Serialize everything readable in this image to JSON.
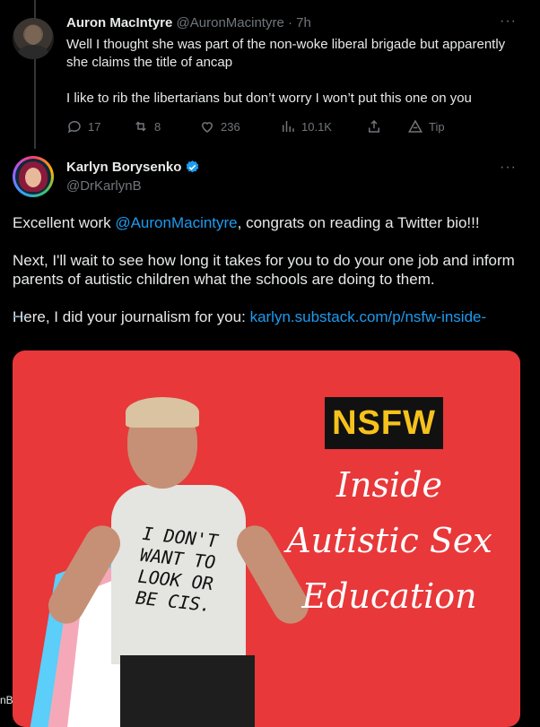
{
  "tweet1": {
    "name": "Auron MacIntyre",
    "handle": "@AuronMacintyre",
    "time": "7h",
    "more": "···",
    "line1": "Well I thought she was part of the non-woke liberal brigade but apparently she claims the title of ancap",
    "line2": "I like to rib the libertarians but don’t worry I won’t put this one on you",
    "actions": {
      "replies": "17",
      "retweets": "8",
      "likes": "236",
      "views": "10.1K",
      "tip": "Tip"
    }
  },
  "tweet2": {
    "name": "Karlyn Borysenko",
    "handle": "@DrKarlynB",
    "more": "···",
    "p1_pre": "Excellent work ",
    "p1_mention": "@AuronMacintyre",
    "p1_post": ", congrats on reading a Twitter bio!!!",
    "p2": "Next, I'll wait to see how long it takes for you to do your one job and inform parents of autistic children what the schools are doing to them.",
    "p3_pre": "Here, I did your journalism for you: ",
    "p3_link": "karlyn.substack.com/p/nsfw-inside-",
    "ellipsis": "…"
  },
  "media": {
    "badge": "NSFW",
    "line1": "Inside",
    "line2": "Autistic Sex",
    "line3": "Education",
    "shirt_l1": "I DON'T",
    "shirt_l2": "WANT TO",
    "shirt_l3": "LOOK OR",
    "shirt_l4": "BE CIS."
  },
  "edge_label": "nB",
  "colors": {
    "accent": "#1d9bf0",
    "muted": "#71767b",
    "media_bg": "#e8383a",
    "badge_text": "#f6c21b"
  }
}
